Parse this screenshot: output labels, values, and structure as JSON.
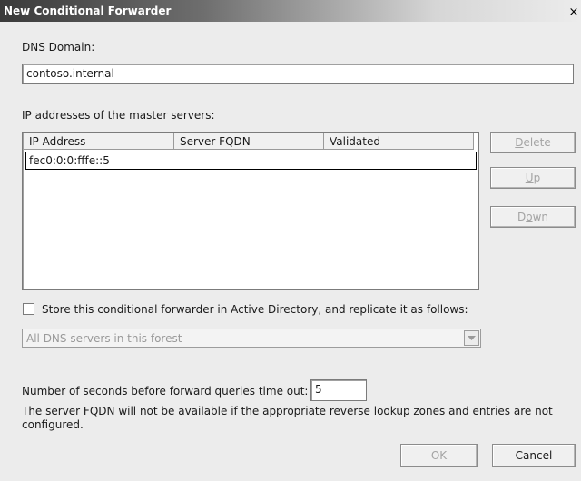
{
  "window": {
    "title": "New Conditional Forwarder",
    "close_glyph": "×"
  },
  "dns_domain": {
    "label": "DNS Domain:",
    "value": "contoso.internal"
  },
  "master_servers": {
    "label": "IP addresses of the master servers:",
    "columns": [
      "IP Address",
      "Server FQDN",
      "Validated"
    ],
    "rows": [
      {
        "ip": "fec0:0:0:fffe::5",
        "fqdn": "",
        "validated": ""
      }
    ]
  },
  "side_buttons": {
    "delete": {
      "accel": "D",
      "rest": "elete"
    },
    "up": {
      "accel": "U",
      "rest": "p"
    },
    "down": {
      "pre": "D",
      "accel": "o",
      "rest": "wn"
    }
  },
  "store_ad": {
    "label": "Store this conditional forwarder in Active Directory, and replicate it as follows:",
    "checked": false,
    "replication_value": "All DNS servers in this forest"
  },
  "timeout": {
    "label": "Number of seconds before forward queries time out:",
    "value": "5"
  },
  "note": "The server FQDN will not be available if the appropriate reverse lookup zones and entries are not configured.",
  "footer": {
    "ok_label": "OK",
    "cancel_label": "Cancel"
  },
  "icons": {
    "close": "close-icon",
    "dropdown": "chevron-down-icon"
  },
  "colors": {
    "dialog_bg": "#ececec",
    "title_dark": "#3a3a3a",
    "disabled_text": "#a4a4a4"
  }
}
